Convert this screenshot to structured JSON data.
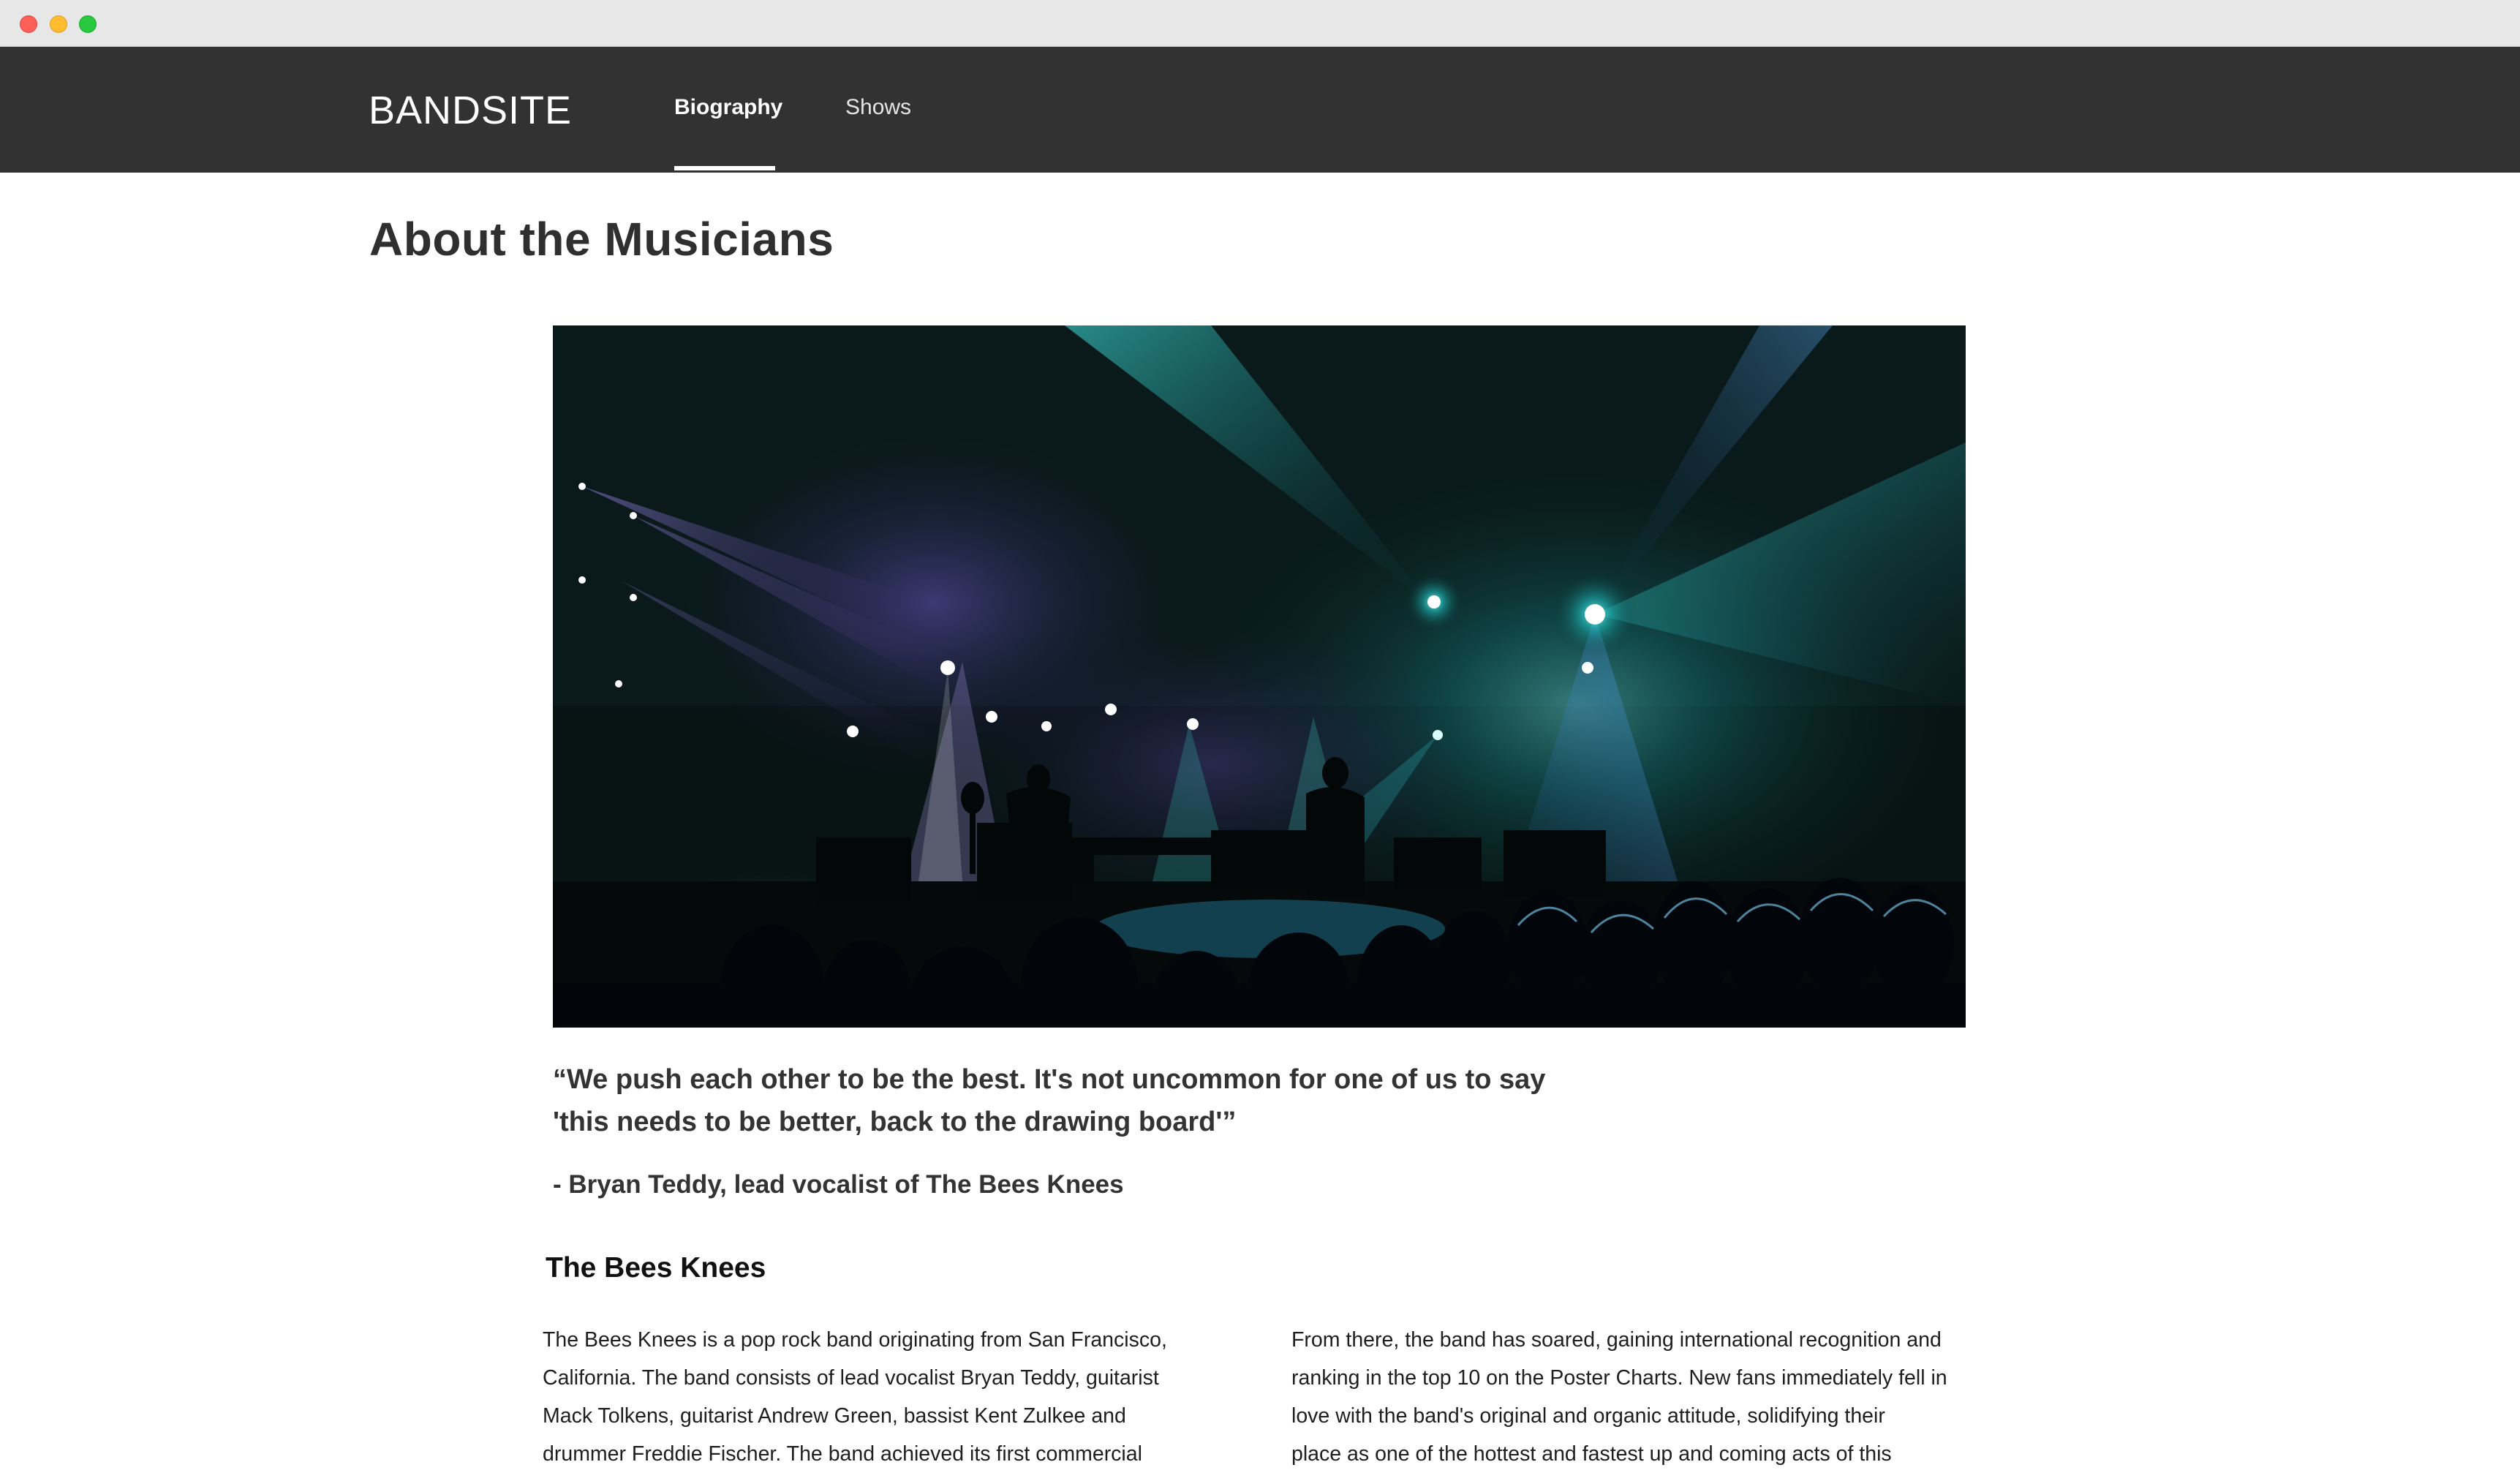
{
  "header": {
    "logo": "BANDSITE",
    "nav": [
      {
        "label": "Biography",
        "active": true
      },
      {
        "label": "Shows",
        "active": false
      }
    ]
  },
  "main": {
    "title": "About the Musicians",
    "hero_image": "concert-stage-photo",
    "quote": {
      "lines": [
        "“We push each other to be the best. It's not uncommon for one of us to say",
        "'this needs to be better, back to the drawing board'”"
      ],
      "attribution": "- Bryan Teddy, lead vocalist of The Bees Knees"
    },
    "section_title": "The Bees Knees",
    "bio_left": [
      "The Bees Knees is a pop rock band originating from San Francisco,",
      "California. The band consists of lead vocalist Bryan Teddy, guitarist",
      "Mack Tolkens, guitarist Andrew Green, bassist Kent Zulkee and",
      "drummer Freddie Fischer. The band achieved its first commercial"
    ],
    "bio_right": [
      "From there, the band has soared, gaining international recognition and",
      "ranking in the top 10 on the Poster Charts. New fans immediately fell in",
      "love with the band's original and organic attitude, solidifying their",
      "place as one of the hottest and fastest up and coming acts of this"
    ]
  },
  "colors": {
    "header_bg": "#323232",
    "text": "#2b2b2b",
    "accent_light": "#27d6d0"
  }
}
